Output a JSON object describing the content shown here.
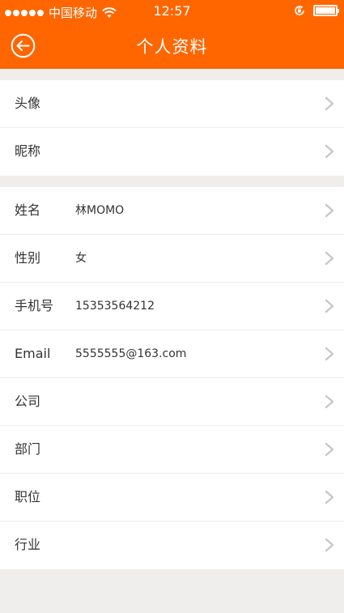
{
  "status_bar": {
    "carrier": "中国移动",
    "time": "12:57",
    "signal_icon": "signal-dots-icon",
    "wifi_icon": "wifi-icon",
    "lock_icon": "rotation-lock-icon",
    "battery_icon": "battery-icon",
    "battery_level": 1.0
  },
  "nav": {
    "title": "个人资料",
    "back_icon": "back-arrow-circle-icon"
  },
  "colors": {
    "accent": "#ff6600",
    "background": "#efeeec",
    "text": "#333333",
    "chevron": "#c7c7cc"
  },
  "group1": [
    {
      "label": "头像",
      "value": ""
    },
    {
      "label": "昵称",
      "value": ""
    }
  ],
  "group2": [
    {
      "label": "姓名",
      "value": "林MOMO"
    },
    {
      "label": "性别",
      "value": "女"
    },
    {
      "label": "手机号",
      "value": "15353564212"
    },
    {
      "label": "Email",
      "value": "5555555@163.com"
    },
    {
      "label": "公司",
      "value": ""
    },
    {
      "label": "部门",
      "value": ""
    },
    {
      "label": "职位",
      "value": ""
    },
    {
      "label": "行业",
      "value": ""
    }
  ]
}
